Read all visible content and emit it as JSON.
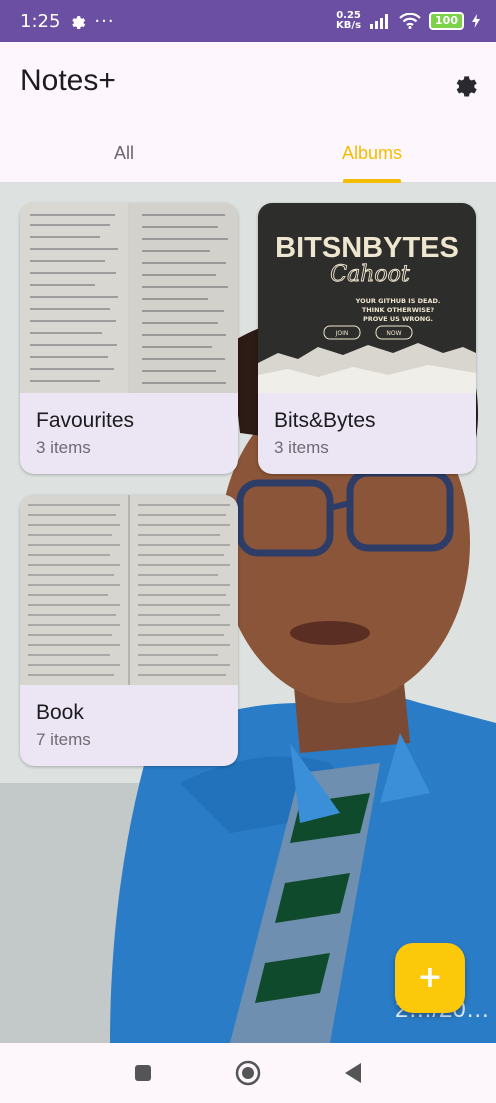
{
  "status_bar": {
    "time": "1:25",
    "icons": [
      "gear-icon",
      "more-icon",
      "signal-icon",
      "wifi-icon",
      "charging-icon"
    ],
    "net_speed_value": "0.25",
    "net_speed_unit": "KB/s",
    "battery": "100"
  },
  "app_bar": {
    "title": "Notes+"
  },
  "tabs": [
    {
      "label": "All",
      "selected": false
    },
    {
      "label": "Albums",
      "selected": true
    }
  ],
  "albums": [
    {
      "name": "Favourites",
      "count": "3 items"
    },
    {
      "name": "Bits&Bytes",
      "count": "3 items"
    },
    {
      "name": "Book",
      "count": "7 items"
    }
  ],
  "bits_poster": {
    "title": "BITSNBYTES",
    "subtitle": "Cahoot",
    "tagline_1": "YOUR GITHUB IS DEAD.",
    "tagline_2": "THINK OTHERWISE?",
    "tagline_3": "PROVE US WRONG.",
    "button_1": "JOIN",
    "button_2": "NOW"
  },
  "wallpaper_date": "2…/20…",
  "fab": {
    "label": "+"
  },
  "colors": {
    "status_bar": "#6b4fa3",
    "accent": "#f4bd00",
    "card_bg": "#ece5f3",
    "fab": "#fbc80a"
  }
}
